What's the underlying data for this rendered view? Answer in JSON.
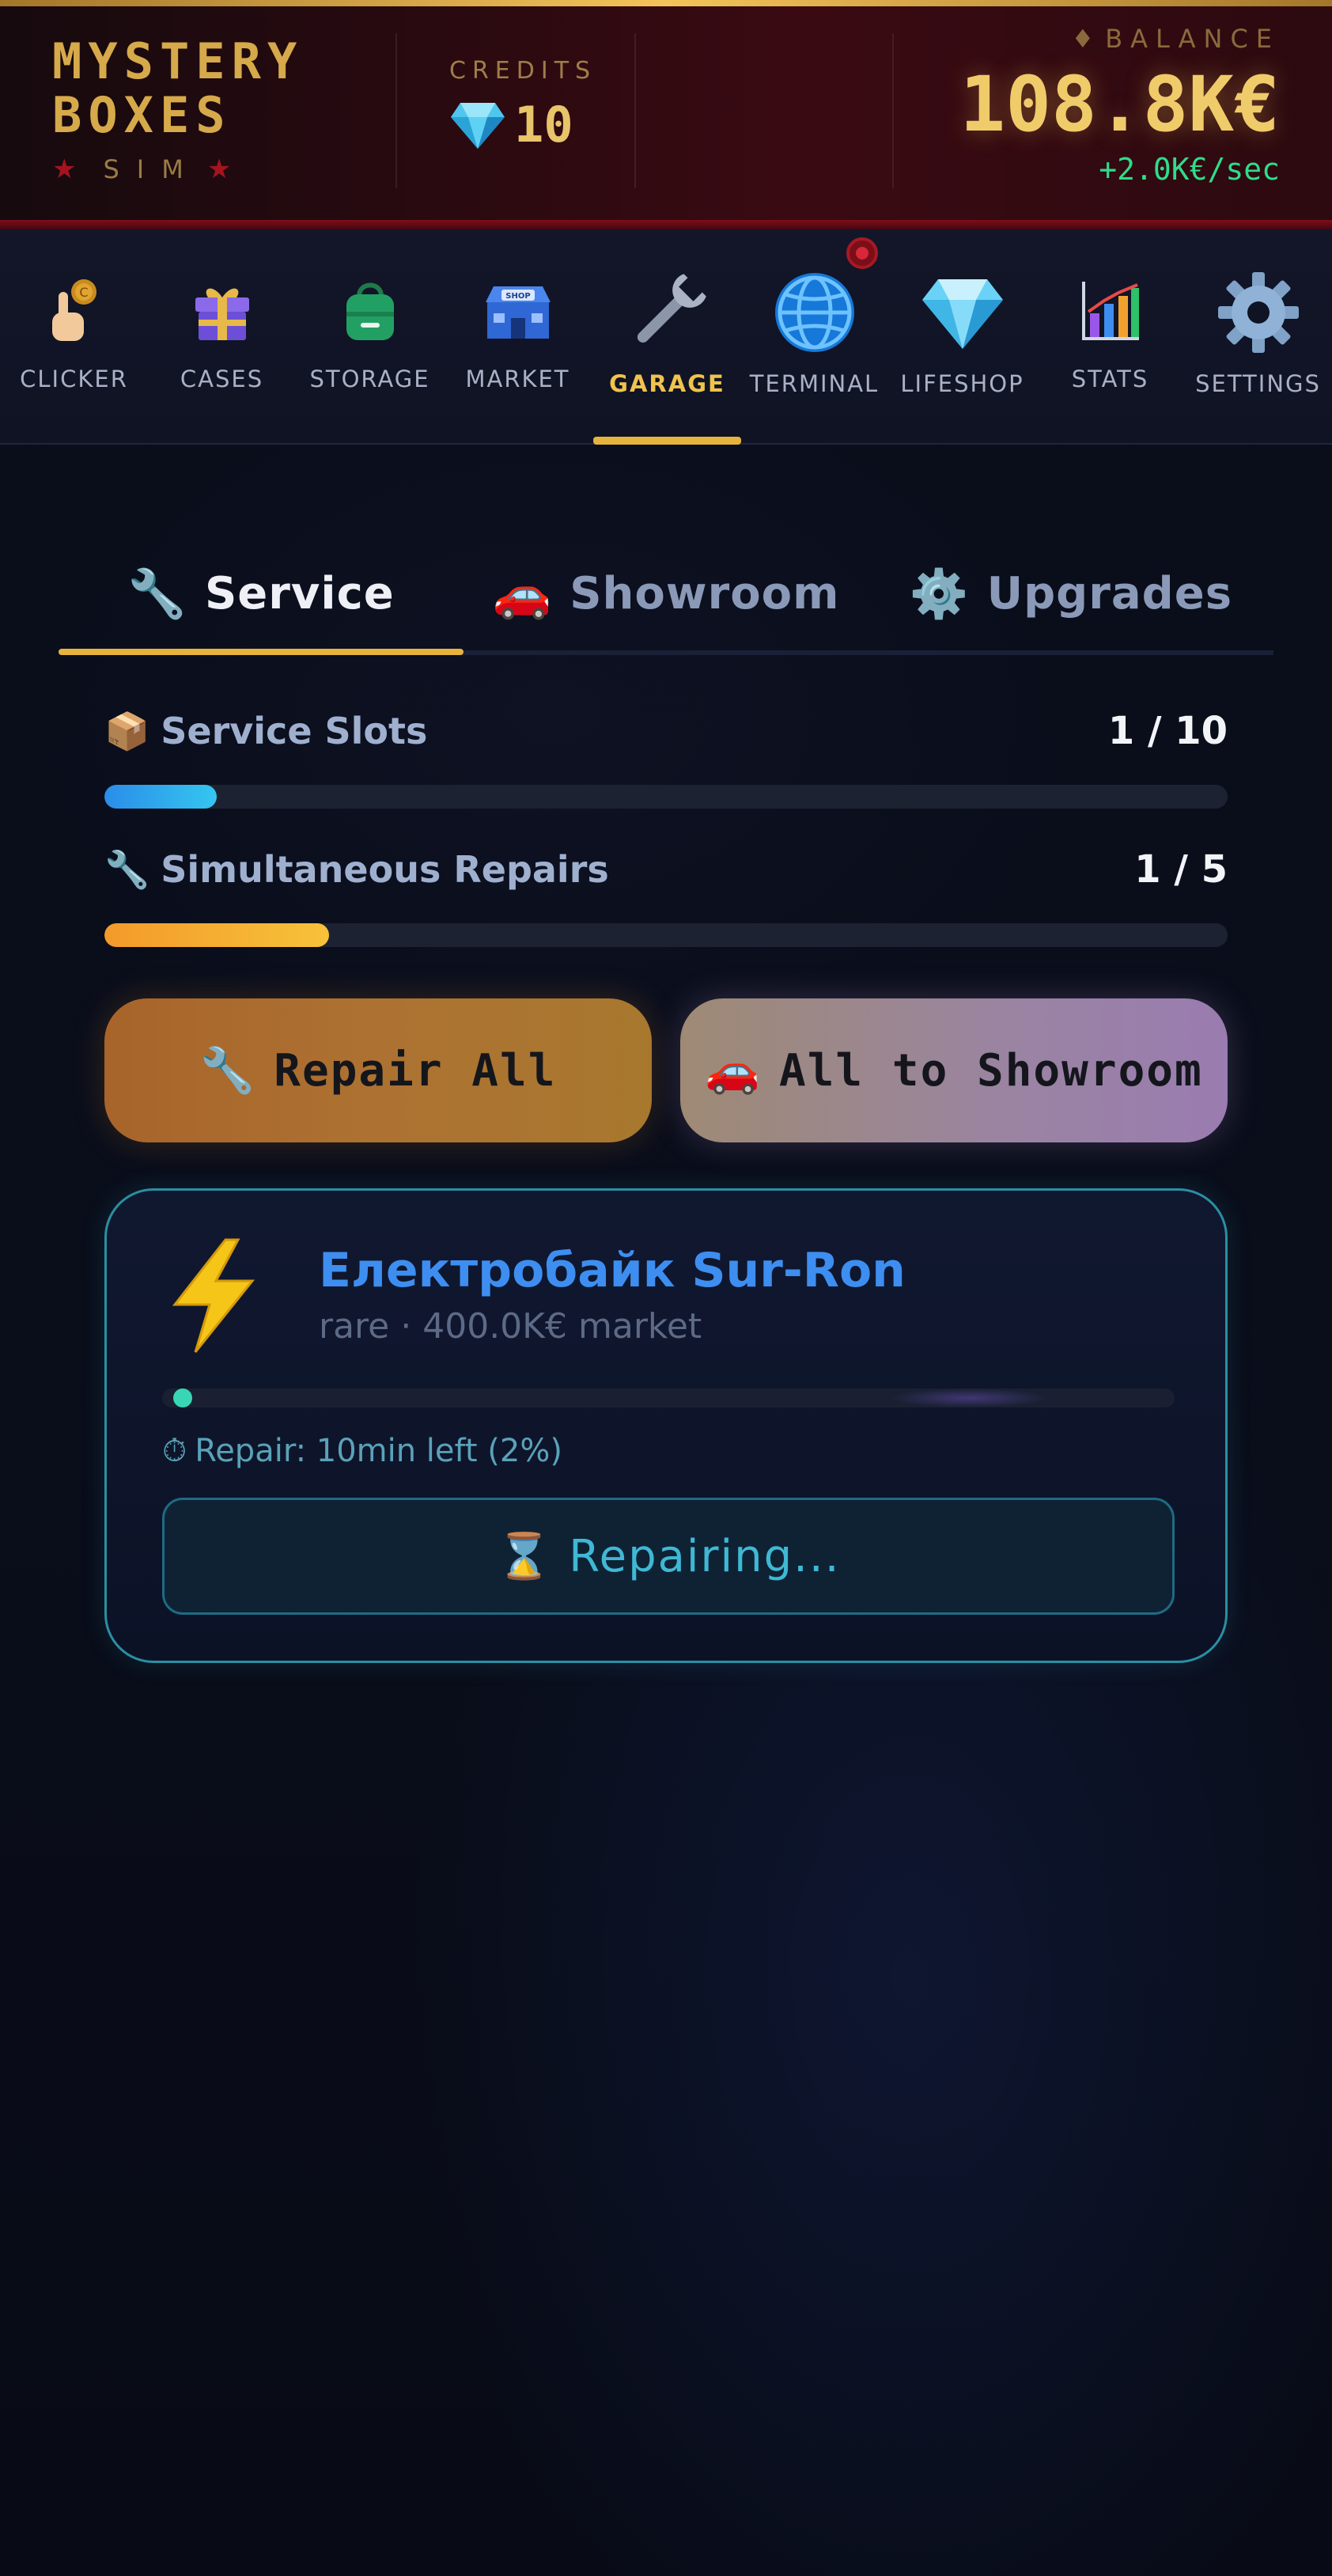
{
  "header": {
    "logo_title": "MYSTERY\nBOXES",
    "logo_subtitle": "SIM",
    "credits_label": "CREDITS",
    "credits_value": "10",
    "balance_label": "BALANCE",
    "balance_value": "108.8K€",
    "balance_rate": "+2.0K€/sec"
  },
  "nav": {
    "items": [
      {
        "label": "CLICKER",
        "icon": "clicker-icon"
      },
      {
        "label": "CASES",
        "icon": "gift-icon"
      },
      {
        "label": "STORAGE",
        "icon": "bag-icon"
      },
      {
        "label": "MARKET",
        "icon": "shop-icon"
      },
      {
        "label": "GARAGE",
        "icon": "wrench-icon",
        "active": true
      },
      {
        "label": "TERMINAL",
        "icon": "globe-icon"
      },
      {
        "label": "LIFESHOP",
        "icon": "diamond-icon"
      },
      {
        "label": "STATS",
        "icon": "chart-icon"
      },
      {
        "label": "SETTINGS",
        "icon": "gear-icon"
      }
    ]
  },
  "tabs": [
    {
      "label": "Service",
      "icon": "🔧",
      "active": true
    },
    {
      "label": "Showroom",
      "icon": "🚗"
    },
    {
      "label": "Upgrades",
      "icon": "⚙️"
    }
  ],
  "stats": {
    "slots": {
      "label": "Service Slots",
      "icon": "📦",
      "value": "1 / 10",
      "progress": 0.1
    },
    "repairs": {
      "label": "Simultaneous Repairs",
      "icon": "🔧",
      "value": "1 / 5",
      "progress": 0.2
    }
  },
  "actions": {
    "repair_all": {
      "icon": "🔧",
      "label": "Repair All"
    },
    "all_to_showroom": {
      "icon": "🚗",
      "label": "All to Showroom"
    }
  },
  "repair_card": {
    "icon": "⚡",
    "title": "Електробайк Sur-Ron",
    "subtitle": "rare · 400.0K€ market",
    "progress": 0.02,
    "status_icon": "⏱",
    "status": "Repair: 10min left (2%)",
    "button_icon": "⌛",
    "button_label": "Repairing..."
  },
  "colors": {
    "gold": "#e6b43c",
    "accent_blue": "#3d8ef0",
    "rate_green": "#2fdc8a",
    "card_border": "#2b8fa2"
  }
}
